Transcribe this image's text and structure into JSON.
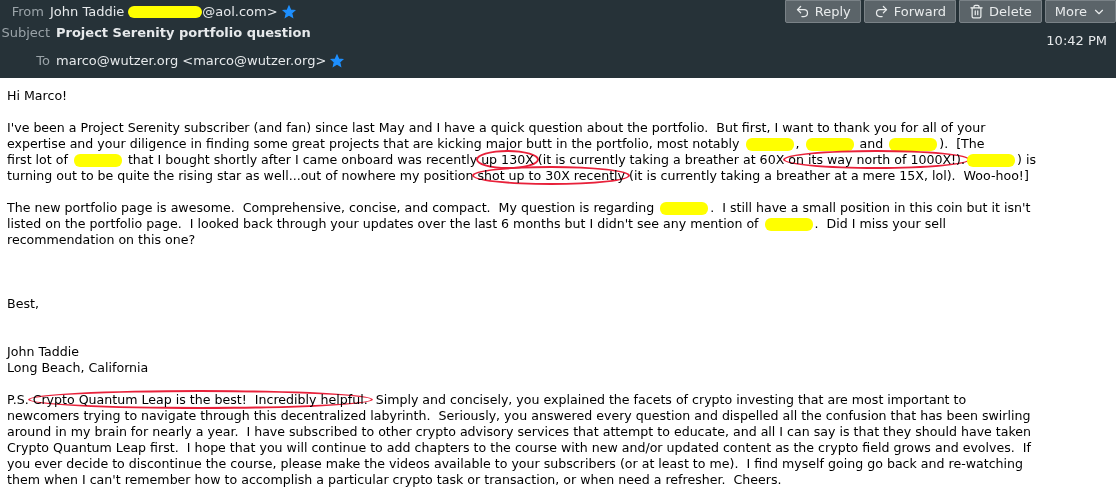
{
  "header": {
    "from": {
      "label": "From",
      "name": "John Taddie",
      "email_suffix": "@aol.com>",
      "starred": true
    },
    "subject": {
      "label": "Subject",
      "text": "Project Serenity portfolio question"
    },
    "to": {
      "label": "To",
      "text": "marco@wutzer.org <marco@wutzer.org>",
      "starred": true
    },
    "time": "10:42 PM",
    "actions": [
      {
        "label": "Reply",
        "kind": "reply"
      },
      {
        "label": "Forward",
        "kind": "forward"
      },
      {
        "label": "Delete",
        "kind": "delete"
      },
      {
        "label": "More",
        "kind": "more"
      }
    ]
  },
  "body": [
    [
      [
        {
          "kind": "plain",
          "text": "Hi Marco!"
        }
      ]
    ],
    [
      [
        {
          "kind": "plain",
          "text": "I've been a Project Serenity subscriber (and fan) since last May and I have a quick question about the portfolio.  But first, I want to thank you for all of your"
        }
      ],
      [
        {
          "kind": "plain",
          "text": "expertise and your diligence in finding some great projects that are kicking major butt in the portfolio, most notably "
        },
        {
          "kind": "redacted"
        },
        {
          "kind": "plain",
          "text": ", "
        },
        {
          "kind": "redacted"
        },
        {
          "kind": "plain",
          "text": " and "
        },
        {
          "kind": "redacted"
        },
        {
          "kind": "plain",
          "text": ").  [The"
        }
      ],
      [
        {
          "kind": "plain",
          "text": "first lot of "
        },
        {
          "kind": "redacted"
        },
        {
          "kind": "plain",
          "text": " that I bought shortly after I came onboard was recently "
        },
        {
          "kind": "circled",
          "text": "up 130X"
        },
        {
          "kind": "plain",
          "text": " (it is currently taking a breather at 60X "
        },
        {
          "kind": "circled",
          "text": "on its way north of 1000X!)."
        },
        {
          "kind": "redacted"
        },
        {
          "kind": "plain",
          "text": ") is"
        }
      ],
      [
        {
          "kind": "plain",
          "text": "turning out to be quite the rising star as well...out of nowhere my position "
        },
        {
          "kind": "circled",
          "text": "shot up to 30X recently"
        },
        {
          "kind": "plain",
          "text": " (it is currently taking a breather at a mere 15X, lol).  Woo-hoo!]"
        }
      ]
    ],
    [
      [
        {
          "kind": "plain",
          "text": "The new portfolio page is awesome.  Comprehensive, concise, and compact.  My question is regarding "
        },
        {
          "kind": "redacted"
        },
        {
          "kind": "plain",
          "text": ".  I still have a small position in this coin but it isn't"
        }
      ],
      [
        {
          "kind": "plain",
          "text": "listed on the portfolio page.  I looked back through your updates over the last 6 months but I didn't see any mention of "
        },
        {
          "kind": "redacted"
        },
        {
          "kind": "plain",
          "text": ".  Did I miss your sell"
        }
      ],
      [
        {
          "kind": "plain",
          "text": "recommendation on this one?"
        }
      ]
    ],
    [
      [
        {
          "kind": "plain",
          "text": "Best,"
        }
      ]
    ],
    [
      [
        {
          "kind": "plain",
          "text": "John Taddie"
        }
      ],
      [
        {
          "kind": "plain",
          "text": "Long Beach, California"
        }
      ]
    ],
    [
      [
        {
          "kind": "plain",
          "text": "P.S. "
        },
        {
          "kind": "circled",
          "text": "Crypto Quantum Leap is the best!  Incredibly helpful."
        },
        {
          "kind": "plain",
          "text": "  Simply and concisely, you explained the facets of crypto investing that are most important to"
        }
      ],
      [
        {
          "kind": "plain",
          "text": "newcomers trying to navigate through this decentralized labyrinth.  Seriously, you answered every question and dispelled all the confusion that has been swirling"
        }
      ],
      [
        {
          "kind": "plain",
          "text": "around in my brain for nearly a year.  I have subscribed to other crypto advisory services that attempt to educate, and all I can say is that they should have taken"
        }
      ],
      [
        {
          "kind": "plain",
          "text": "Crypto Quantum Leap first.  I hope that you will continue to add chapters to the course with new and/or updated content as the crypto field grows and evolves.  If"
        }
      ],
      [
        {
          "kind": "plain",
          "text": "you ever decide to discontinue the course, please make the videos available to your subscribers (or at least to me).  I find myself going go back and re-watching"
        }
      ],
      [
        {
          "kind": "plain",
          "text": "them when I can't remember how to accomplish a particular crypto task or transaction, or when need a refresher.  Cheers."
        }
      ]
    ]
  ]
}
